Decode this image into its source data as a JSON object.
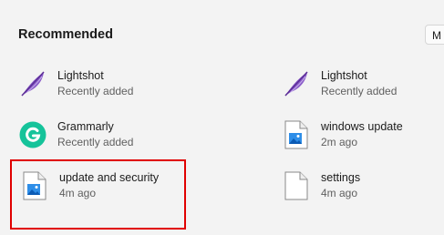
{
  "section": {
    "title": "Recommended",
    "more_label": "M"
  },
  "items": [
    {
      "name": "Lightshot",
      "subtitle": "Recently added",
      "icon": "feather-icon"
    },
    {
      "name": "Lightshot",
      "subtitle": "Recently added",
      "icon": "feather-icon"
    },
    {
      "name": "Grammarly",
      "subtitle": "Recently added",
      "icon": "grammarly-icon"
    },
    {
      "name": "windows update",
      "subtitle": "2m ago",
      "icon": "image-file-icon"
    },
    {
      "name": "update and security",
      "subtitle": "4m ago",
      "icon": "image-file-icon"
    },
    {
      "name": "settings",
      "subtitle": "4m ago",
      "icon": "blank-file-icon"
    }
  ],
  "colors": {
    "highlight": "#e00000",
    "grammarly": "#15c39a",
    "feather": "#8a5cc9"
  }
}
